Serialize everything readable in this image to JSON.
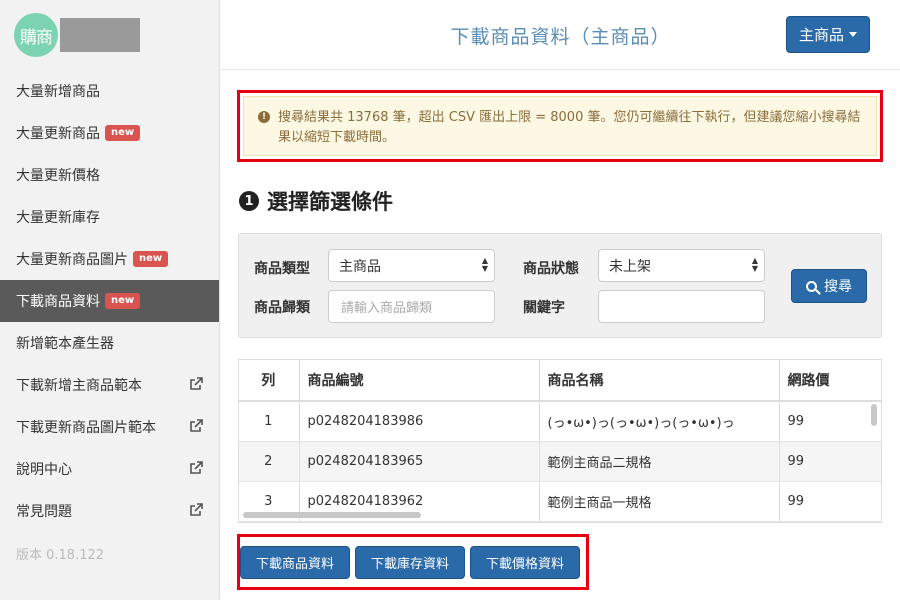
{
  "brand": {
    "logo_text": "購商"
  },
  "sidebar": {
    "items": [
      {
        "label": "大量新增商品"
      },
      {
        "label": "大量更新商品",
        "badge": "new"
      },
      {
        "label": "大量更新價格"
      },
      {
        "label": "大量更新庫存"
      },
      {
        "label": "大量更新商品圖片",
        "badge": "new"
      },
      {
        "label": "下載商品資料",
        "badge": "new",
        "active": true
      },
      {
        "label": "新增範本產生器"
      },
      {
        "label": "下載新增主商品範本",
        "external": true
      },
      {
        "label": "下載更新商品圖片範本",
        "external": true
      },
      {
        "label": "說明中心",
        "external": true
      },
      {
        "label": "常見問題",
        "external": true
      }
    ],
    "version": "版本 0.18.122"
  },
  "header": {
    "title": "下載商品資料（主商品）",
    "product_type_button": "主商品"
  },
  "alert": {
    "icon": "exclamation-circle-icon",
    "text": "搜尋結果共 13768 筆，超出 CSV 匯出上限 = 8000 筆。您仍可繼續往下執行，但建議您縮小搜尋結果以縮短下載時間。"
  },
  "section": {
    "number": "1",
    "title": "選擇篩選條件"
  },
  "filters": {
    "product_type_label": "商品類型",
    "product_type_value": "主商品",
    "product_status_label": "商品狀態",
    "product_status_value": "未上架",
    "category_label": "商品歸類",
    "category_placeholder": "請輸入商品歸類",
    "keyword_label": "關鍵字",
    "keyword_value": "",
    "search_button": "搜尋"
  },
  "table": {
    "headers": [
      "列",
      "商品編號",
      "商品名稱",
      "網路價"
    ],
    "rows": [
      [
        "1",
        "p0248204183986",
        "(っ•ω•)っ(っ•ω•)っ(っ•ω•)っ",
        "99"
      ],
      [
        "2",
        "p0248204183965",
        "範例主商品二規格",
        "99"
      ],
      [
        "3",
        "p0248204183962",
        "範例主商品一規格",
        "99"
      ]
    ]
  },
  "actions": {
    "download_product": "下載商品資料",
    "download_inventory": "下載庫存資料",
    "download_price": "下載價格資料"
  },
  "colors": {
    "primary": "#2a6aa8",
    "badge": "#d9534f",
    "highlight_outline": "#e60012",
    "alert_bg": "#fcf8e3",
    "alert_text": "#8a6d3b"
  }
}
